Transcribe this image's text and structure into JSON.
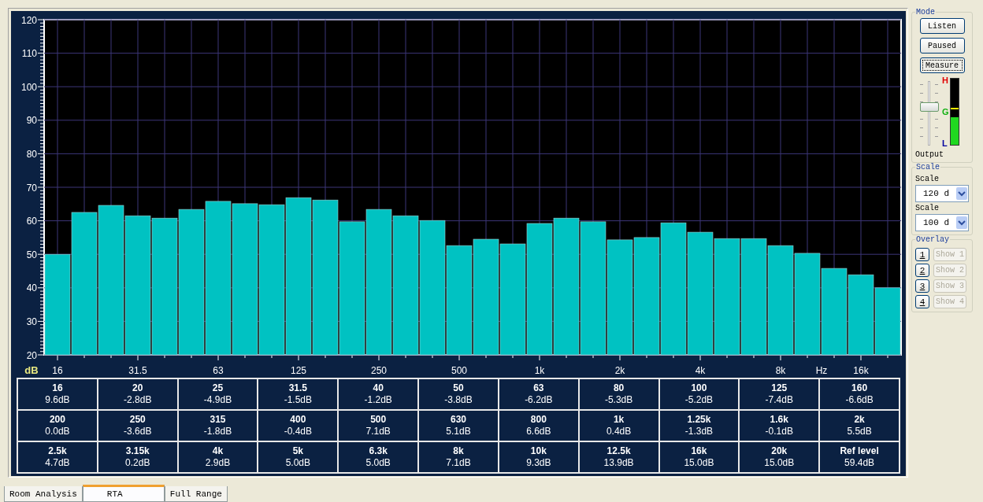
{
  "chart": {
    "chart_data": {
      "type": "bar",
      "xlabel": "Hz",
      "ylabel": "dB",
      "grid": true,
      "categories": [
        "16",
        null,
        null,
        "31.5",
        null,
        null,
        "63",
        null,
        null,
        "125",
        null,
        null,
        "250",
        null,
        null,
        "500",
        null,
        null,
        "1k",
        null,
        null,
        "2k",
        null,
        null,
        "4k",
        null,
        null,
        "8k",
        null,
        null,
        "16k",
        null
      ],
      "values": [
        50.0,
        62.5,
        64.6,
        61.5,
        60.8,
        63.4,
        65.8,
        65.1,
        64.8,
        66.9,
        66.2,
        59.7,
        63.4,
        61.5,
        60.1,
        52.6,
        54.5,
        53.1,
        59.2,
        60.8,
        59.7,
        54.3,
        55.0,
        59.4,
        56.6,
        54.7,
        54.7,
        52.6,
        50.3,
        45.8,
        43.9,
        40.0
      ],
      "ylim": [
        20,
        120
      ],
      "yticks": [
        20,
        30,
        40,
        50,
        60,
        70,
        80,
        90,
        100,
        110,
        120
      ]
    }
  },
  "band_table": [
    [
      {
        "freq": "16",
        "value": "9.6dB"
      },
      {
        "freq": "20",
        "value": "-2.8dB"
      },
      {
        "freq": "25",
        "value": "-4.9dB"
      },
      {
        "freq": "31.5",
        "value": "-1.5dB"
      },
      {
        "freq": "40",
        "value": "-1.2dB"
      },
      {
        "freq": "50",
        "value": "-3.8dB"
      },
      {
        "freq": "63",
        "value": "-6.2dB"
      },
      {
        "freq": "80",
        "value": "-5.3dB"
      },
      {
        "freq": "100",
        "value": "-5.2dB"
      },
      {
        "freq": "125",
        "value": "-7.4dB"
      },
      {
        "freq": "160",
        "value": "-6.6dB"
      }
    ],
    [
      {
        "freq": "200",
        "value": "0.0dB"
      },
      {
        "freq": "250",
        "value": "-3.6dB"
      },
      {
        "freq": "315",
        "value": "-1.8dB"
      },
      {
        "freq": "400",
        "value": "-0.4dB"
      },
      {
        "freq": "500",
        "value": "7.1dB"
      },
      {
        "freq": "630",
        "value": "5.1dB"
      },
      {
        "freq": "800",
        "value": "6.6dB"
      },
      {
        "freq": "1k",
        "value": "0.4dB"
      },
      {
        "freq": "1.25k",
        "value": "-1.3dB"
      },
      {
        "freq": "1.6k",
        "value": "-0.1dB"
      },
      {
        "freq": "2k",
        "value": "5.5dB"
      }
    ],
    [
      {
        "freq": "2.5k",
        "value": "4.7dB"
      },
      {
        "freq": "3.15k",
        "value": "0.2dB"
      },
      {
        "freq": "4k",
        "value": "2.9dB"
      },
      {
        "freq": "5k",
        "value": "5.0dB"
      },
      {
        "freq": "6.3k",
        "value": "5.0dB"
      },
      {
        "freq": "8k",
        "value": "7.1dB"
      },
      {
        "freq": "10k",
        "value": "9.3dB"
      },
      {
        "freq": "12.5k",
        "value": "13.9dB"
      },
      {
        "freq": "16k",
        "value": "15.0dB"
      },
      {
        "freq": "20k",
        "value": "15.0dB"
      },
      {
        "freq": "Ref level",
        "value": "59.4dB"
      }
    ]
  ],
  "mode": {
    "title": "Mode",
    "buttons": [
      {
        "label": "Listen",
        "selected": false
      },
      {
        "label": "Paused",
        "selected": false
      },
      {
        "label": "Measure",
        "selected": true
      }
    ],
    "output": {
      "label": "Output",
      "level": 0.62
    },
    "meter": {
      "level": 0.42,
      "labels": [
        "H",
        "G",
        "L"
      ]
    }
  },
  "scale": {
    "title": "Scale",
    "selects": [
      {
        "label": "Scale",
        "value": "120 d"
      },
      {
        "label": "Scale",
        "value": "100 d"
      }
    ]
  },
  "overlay": {
    "title": "Overlay",
    "items": [
      {
        "key": "1",
        "show": "Show 1",
        "disabled": true
      },
      {
        "key": "2",
        "show": "Show 2",
        "disabled": true
      },
      {
        "key": "3",
        "show": "Show 3",
        "disabled": true
      },
      {
        "key": "4",
        "show": "Show 4",
        "disabled": true
      }
    ]
  },
  "tabs": [
    {
      "label": "Room Analysis",
      "selected": false
    },
    {
      "label": "RTA",
      "selected": true
    },
    {
      "label": "Full Range",
      "selected": false
    }
  ]
}
